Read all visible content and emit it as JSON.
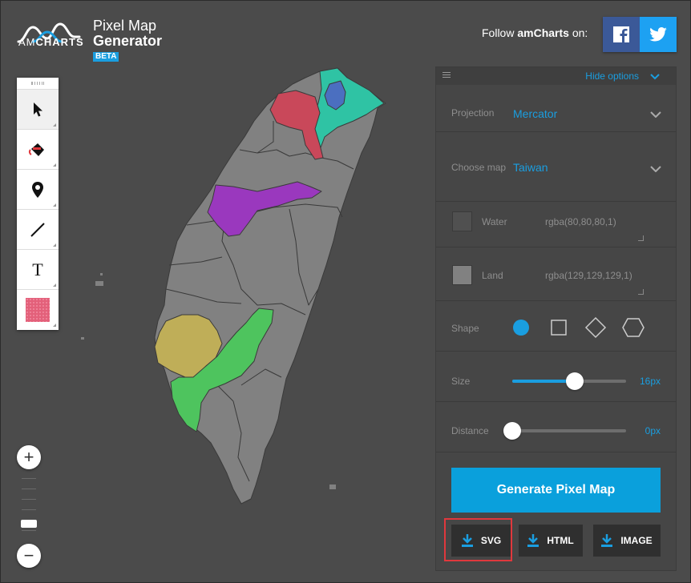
{
  "brand": {
    "logo_text_light": "AM",
    "logo_text_bold": "CHARTS",
    "title_line1": "Pixel Map",
    "title_line2": "Generator",
    "badge": "BETA"
  },
  "follow": {
    "text": "Follow",
    "brand": "amCharts",
    "suffix": "on:",
    "facebook_icon": "facebook-icon",
    "twitter_icon": "twitter-icon"
  },
  "toolbar": {
    "tools": [
      "select-tool",
      "fill-tool",
      "pin-tool",
      "line-tool",
      "text-tool",
      "pattern-tool"
    ],
    "text_tool_label": "T"
  },
  "zoom": {
    "plus": "+",
    "minus": "−"
  },
  "panel": {
    "hide_options": "Hide options",
    "projection": {
      "label": "Projection",
      "value": "Mercator"
    },
    "choose_map": {
      "label": "Choose map",
      "value": "Taiwan"
    },
    "water": {
      "label": "Water",
      "value": "rgba(80,80,80,1)",
      "color": "#505050"
    },
    "land": {
      "label": "Land",
      "value": "rgba(129,129,129,1)",
      "color": "#818181"
    },
    "shape": {
      "label": "Shape",
      "options": [
        "circle",
        "square",
        "diamond",
        "hexagon"
      ],
      "selected": "circle"
    },
    "size": {
      "label": "Size",
      "value": "16px",
      "level": 0.55
    },
    "distance": {
      "label": "Distance",
      "value": "0px",
      "level": 0.0
    },
    "generate": "Generate Pixel Map",
    "downloads": [
      "SVG",
      "HTML",
      "IMAGE"
    ]
  },
  "colors": {
    "accent": "#1a9ee0",
    "land": "#818181",
    "highlight_red": "#e0383d"
  }
}
